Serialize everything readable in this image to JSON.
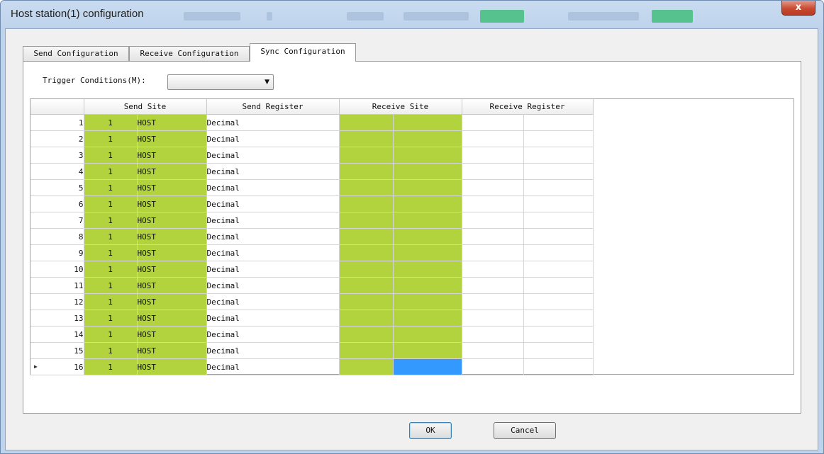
{
  "window": {
    "title": "Host station(1) configuration",
    "close_label": "x"
  },
  "tabs": [
    {
      "label": "Send Configuration"
    },
    {
      "label": "Receive Configuration"
    },
    {
      "label": "Sync Configuration"
    }
  ],
  "active_tab": "Sync Configuration",
  "trigger": {
    "label": "Trigger Conditions(M):",
    "value": ""
  },
  "grid": {
    "headers": {
      "send_site": "Send Site",
      "send_register": "Send Register",
      "receive_site": "Receive Site",
      "receive_register": "Receive Register"
    },
    "rows": [
      {
        "no": "1",
        "site": "1",
        "name": "HOST",
        "reg": "Decimal"
      },
      {
        "no": "2",
        "site": "1",
        "name": "HOST",
        "reg": "Decimal"
      },
      {
        "no": "3",
        "site": "1",
        "name": "HOST",
        "reg": "Decimal"
      },
      {
        "no": "4",
        "site": "1",
        "name": "HOST",
        "reg": "Decimal"
      },
      {
        "no": "5",
        "site": "1",
        "name": "HOST",
        "reg": "Decimal"
      },
      {
        "no": "6",
        "site": "1",
        "name": "HOST",
        "reg": "Decimal"
      },
      {
        "no": "7",
        "site": "1",
        "name": "HOST",
        "reg": "Decimal"
      },
      {
        "no": "8",
        "site": "1",
        "name": "HOST",
        "reg": "Decimal"
      },
      {
        "no": "9",
        "site": "1",
        "name": "HOST",
        "reg": "Decimal"
      },
      {
        "no": "10",
        "site": "1",
        "name": "HOST",
        "reg": "Decimal"
      },
      {
        "no": "11",
        "site": "1",
        "name": "HOST",
        "reg": "Decimal"
      },
      {
        "no": "12",
        "site": "1",
        "name": "HOST",
        "reg": "Decimal"
      },
      {
        "no": "13",
        "site": "1",
        "name": "HOST",
        "reg": "Decimal"
      },
      {
        "no": "14",
        "site": "1",
        "name": "HOST",
        "reg": "Decimal"
      },
      {
        "no": "15",
        "site": "1",
        "name": "HOST",
        "reg": "Decimal"
      },
      {
        "no": "16",
        "site": "1",
        "name": "HOST",
        "reg": "Decimal"
      }
    ],
    "current_row_marker": "▶"
  },
  "buttons": {
    "ok": "OK",
    "cancel": "Cancel"
  },
  "colors": {
    "site_cell": "#b3d33e",
    "selection": "#3399ff"
  }
}
